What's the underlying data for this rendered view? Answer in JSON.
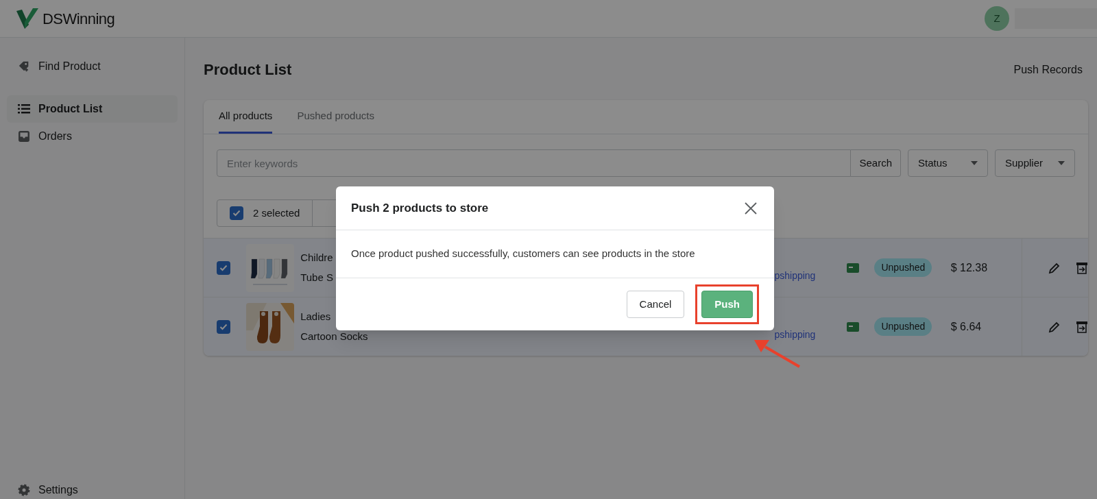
{
  "header": {
    "logo": "DSWinning",
    "avatar": "Z"
  },
  "sidebar": {
    "items": [
      {
        "label": "Find Product",
        "selected": false
      },
      {
        "label": "Product List",
        "selected": true
      },
      {
        "label": "Orders",
        "selected": false
      }
    ],
    "footer_item": {
      "label": "Settings"
    }
  },
  "page": {
    "title": "Product List",
    "action": "Push Records"
  },
  "tabs": [
    {
      "label": "All products",
      "selected": true
    },
    {
      "label": "Pushed products",
      "selected": false
    }
  ],
  "search": {
    "placeholder": "Enter keywords",
    "button": "Search"
  },
  "filters": [
    {
      "label": "Status"
    },
    {
      "label": "Supplier"
    }
  ],
  "bulk": {
    "checked": true,
    "label": "2 selected"
  },
  "rows": [
    {
      "checked": true,
      "name_lines": [
        "Childre",
        "Tube S"
      ],
      "supplier": "pshipping",
      "status": "Unpushed",
      "price": "$ 12.38"
    },
    {
      "checked": true,
      "name_lines": [
        "Ladies",
        "Cartoon Socks"
      ],
      "supplier": "pshipping",
      "status": "Unpushed",
      "price": "$ 6.64"
    }
  ],
  "modal": {
    "title": "Push 2 products to store",
    "body": "Once product pushed successfully, customers can see products in the store",
    "buttons": [
      {
        "label": "Cancel",
        "kind": "secondary"
      },
      {
        "label": "Push",
        "kind": "primary",
        "highlighted": true
      }
    ]
  }
}
